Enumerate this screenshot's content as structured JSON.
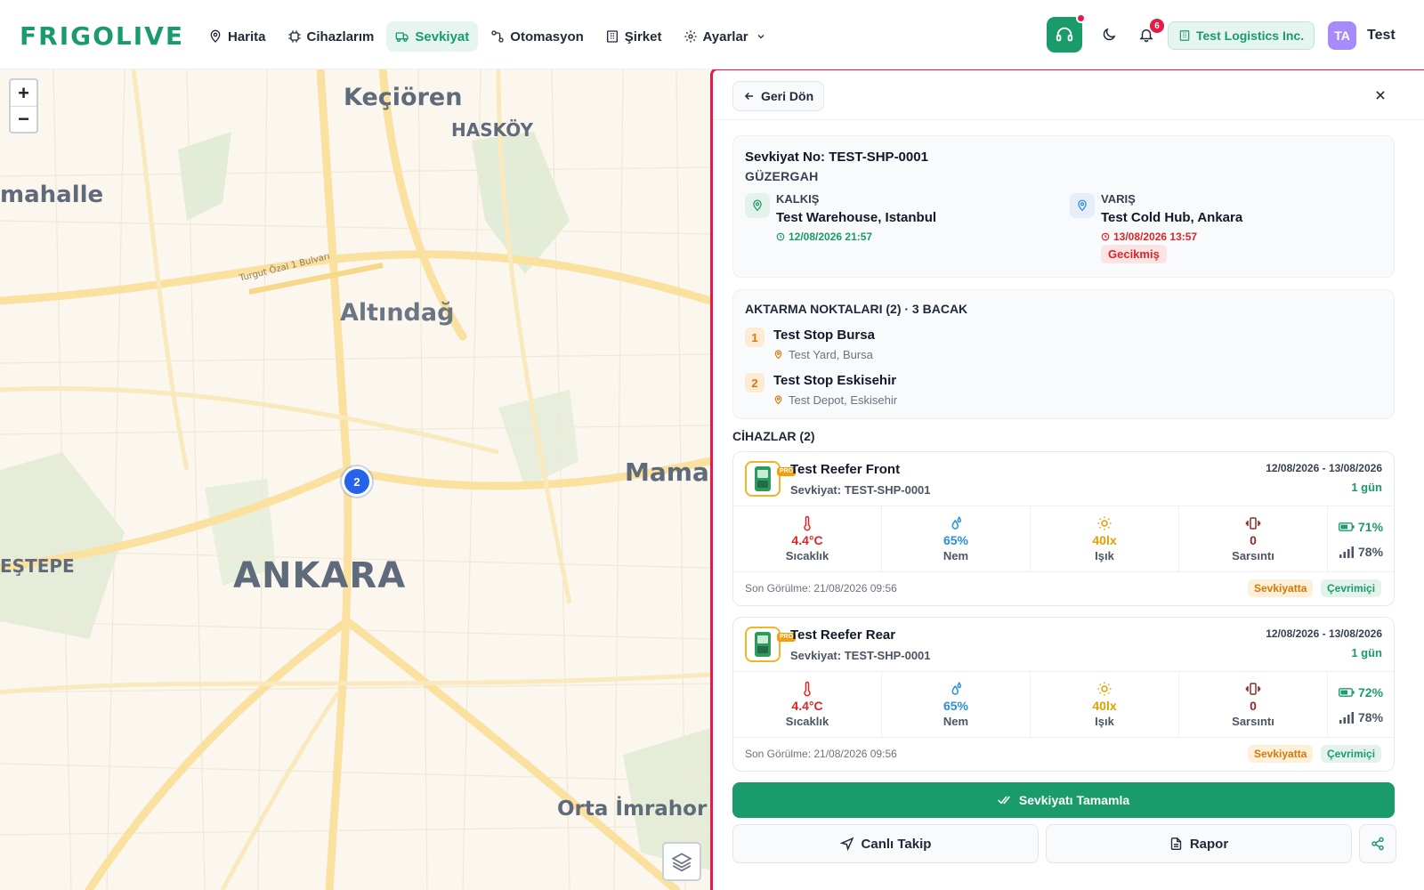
{
  "app": {
    "logo_text": "FRIGOLIVE"
  },
  "nav": [
    {
      "label": "Harita",
      "icon": "map-pin-icon"
    },
    {
      "label": "Cihazlarım",
      "icon": "chip-icon"
    },
    {
      "label": "Sevkiyat",
      "icon": "truck-icon",
      "active": true
    },
    {
      "label": "Otomasyon",
      "icon": "workflow-icon"
    },
    {
      "label": "Şirket",
      "icon": "building-icon"
    },
    {
      "label": "Ayarlar",
      "icon": "gear-icon"
    }
  ],
  "header": {
    "notification_count": "6",
    "company": "Test Logistics Inc.",
    "avatar_initials": "TA",
    "user_name": "Test"
  },
  "map": {
    "labels": {
      "kecioren": "Keçiören",
      "haskoy": "HASKÖY",
      "mahalle": "mahalle",
      "altindag": "Altındağ",
      "ankara": "ANKARA",
      "mama": "Mama",
      "estepe": "EŞTEPE",
      "orta": "Orta İmrahor",
      "bulvar": "Turgut Özal 1 Bulvarı"
    },
    "zoom_in": "+",
    "zoom_out": "−",
    "cluster_count": "2"
  },
  "panel": {
    "back_label": "Geri Dön",
    "shipment_prefix": "Sevkiyat No:",
    "shipment_no": "TEST-SHP-0001",
    "route_title": "GÜZERGAH",
    "departure": {
      "label": "KALKIŞ",
      "place": "Test Warehouse, Istanbul",
      "time": "12/08/2026 21:57"
    },
    "arrival": {
      "label": "VARIŞ",
      "place": "Test Cold Hub, Ankara",
      "time": "13/08/2026 13:57",
      "status": "Gecikmiş"
    },
    "stops_title": "AKTARMA NOKTALARI (2) · 3 BACAK",
    "stops": [
      {
        "num": "1",
        "name": "Test Stop Bursa",
        "address": "Test Yard, Bursa"
      },
      {
        "num": "2",
        "name": "Test Stop Eskisehir",
        "address": "Test Depot, Eskisehir"
      }
    ],
    "devices_title": "CİHAZLAR (2)",
    "devices": [
      {
        "name": "Test Reefer Front",
        "shipment": "Sevkiyat: TEST-SHP-0001",
        "dates": "12/08/2026 - 13/08/2026",
        "days": "1 gün",
        "pro_tag": "PRO",
        "temperature": "4.4°C",
        "temperature_label": "Sıcaklık",
        "humidity": "65%",
        "humidity_label": "Nem",
        "light": "40lx",
        "light_label": "Işık",
        "shock": "0",
        "shock_label": "Sarsıntı",
        "battery": "71%",
        "signal": "78%",
        "last_seen": "Son Görülme: 21/08/2026 09:56",
        "status_transit": "Sevkiyatta",
        "status_online": "Çevrimiçi"
      },
      {
        "name": "Test Reefer Rear",
        "shipment": "Sevkiyat: TEST-SHP-0001",
        "dates": "12/08/2026 - 13/08/2026",
        "days": "1 gün",
        "pro_tag": "PRO",
        "temperature": "4.4°C",
        "temperature_label": "Sıcaklık",
        "humidity": "65%",
        "humidity_label": "Nem",
        "light": "40lx",
        "light_label": "Işık",
        "shock": "0",
        "shock_label": "Sarsıntı",
        "battery": "72%",
        "signal": "78%",
        "last_seen": "Son Görülme: 21/08/2026 09:56",
        "status_transit": "Sevkiyatta",
        "status_online": "Çevrimiçi"
      }
    ],
    "complete_label": "Sevkiyatı Tamamla",
    "live_track_label": "Canlı Takip",
    "report_label": "Rapor"
  },
  "colors": {
    "brand": "#1a9b6c",
    "alert": "#e11d48",
    "temperature": "#dc2626",
    "humidity": "#2b8fd6",
    "light": "#e0a100",
    "shock": "#8b2d2d"
  }
}
